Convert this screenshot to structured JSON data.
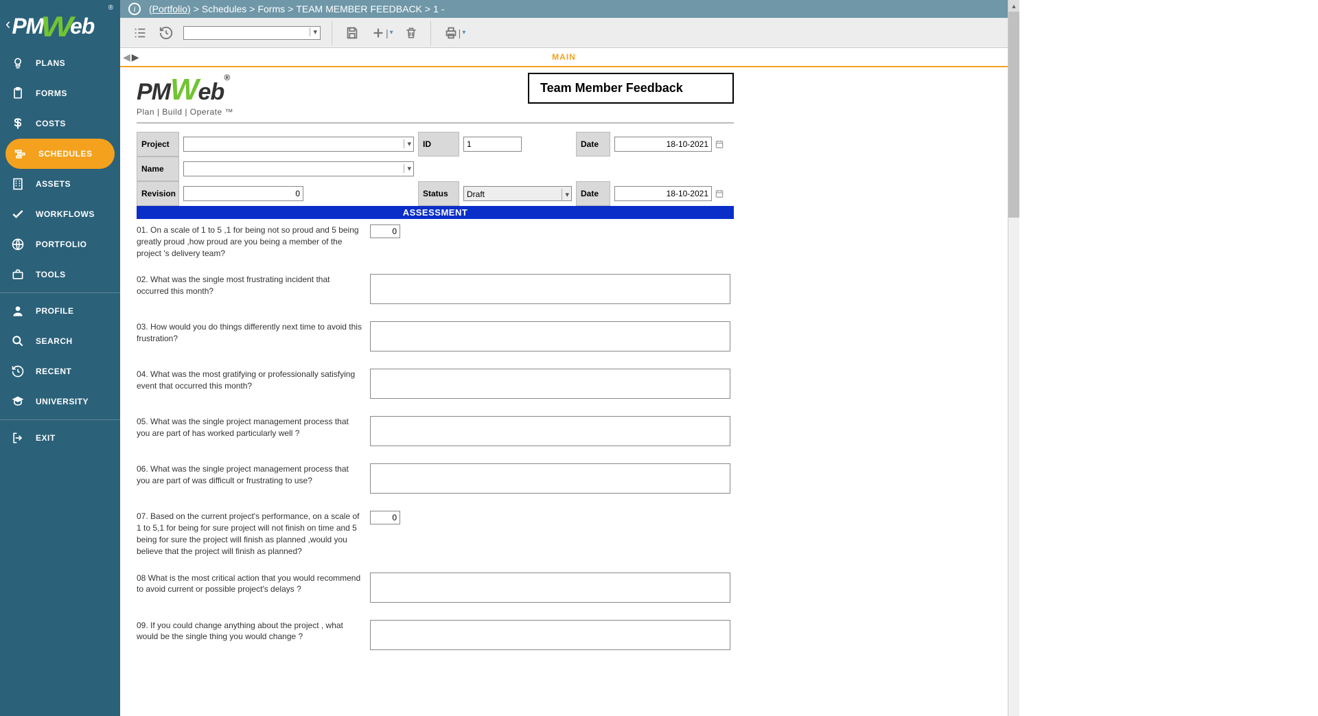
{
  "logo": {
    "pm": "PM",
    "w": "W",
    "eb": "eb"
  },
  "breadcrumb": {
    "link": "(Portfolio)",
    "parts": [
      "Schedules",
      "Forms",
      "TEAM MEMBER FEEDBACK",
      "1 -"
    ]
  },
  "sidebar": {
    "items": [
      {
        "label": "PLANS"
      },
      {
        "label": "FORMS"
      },
      {
        "label": "COSTS"
      },
      {
        "label": "SCHEDULES"
      },
      {
        "label": "ASSETS"
      },
      {
        "label": "WORKFLOWS"
      },
      {
        "label": "PORTFOLIO"
      },
      {
        "label": "TOOLS"
      }
    ],
    "items2": [
      {
        "label": "PROFILE"
      },
      {
        "label": "SEARCH"
      },
      {
        "label": "RECENT"
      },
      {
        "label": "UNIVERSITY"
      }
    ],
    "items3": [
      {
        "label": "EXIT"
      }
    ]
  },
  "tabs": {
    "main": "MAIN"
  },
  "form": {
    "title": "Team Member Feedback",
    "tagline": "Plan | Build | Operate ™",
    "labels": {
      "project": "Project",
      "id": "ID",
      "date": "Date",
      "name": "Name",
      "revision": "Revision",
      "status": "Status"
    },
    "values": {
      "project": "",
      "id": "1",
      "date1": "18-10-2021",
      "name": "",
      "revision": "0",
      "status": "Draft",
      "date2": "18-10-2021"
    },
    "assessment_title": "ASSESSMENT",
    "questions": [
      {
        "num": "01.",
        "text": "On a scale of 1 to 5 ,1 for being not so proud and 5 being greatly proud ,how proud are you being a member of the project 's delivery team?",
        "type": "num",
        "value": "0"
      },
      {
        "num": "02.",
        "text": "What was the single most frustrating incident that occurred this month?",
        "type": "text",
        "value": ""
      },
      {
        "num": "03.",
        "text": "How would you do things differently next time to avoid this frustration?",
        "type": "text",
        "value": ""
      },
      {
        "num": "04.",
        "text": "What was the most gratifying or professionally satisfying event that occurred this month?",
        "type": "text",
        "value": ""
      },
      {
        "num": "05.",
        "text": "What was the single project management process that you are part of has worked particularly well ?",
        "type": "text",
        "value": ""
      },
      {
        "num": "06.",
        "text": "What was the single project management process that you are part of was difficult or frustrating to use?",
        "type": "text",
        "value": ""
      },
      {
        "num": "07.",
        "text": "Based on the current project's performance, on a scale of 1 to 5,1 for being for sure project will not finish on time and 5 being for sure the project will finish as planned ,would you believe that the project will finish as planned?",
        "type": "num",
        "value": "0"
      },
      {
        "num": "08",
        "text": "What is the most critical action that you would recommend to avoid current or possible project's delays ?",
        "type": "text",
        "value": ""
      },
      {
        "num": "09.",
        "text": "If you could change anything about the project , what would be the single thing you would change ?",
        "type": "text",
        "value": ""
      }
    ]
  }
}
